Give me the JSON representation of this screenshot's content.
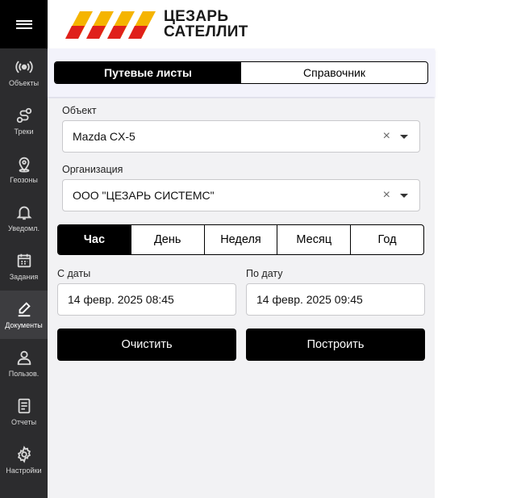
{
  "brand": {
    "line1": "ЦЕЗАРЬ",
    "line2": "САТЕЛЛИТ",
    "accent": "#f5b400",
    "accent2": "#e0201b"
  },
  "sidebar": {
    "items": [
      {
        "label": "Объекты",
        "icon": "broadcast-icon"
      },
      {
        "label": "Треки",
        "icon": "route-icon"
      },
      {
        "label": "Геозоны",
        "icon": "map-pin-icon"
      },
      {
        "label": "Уведомл.",
        "icon": "bell-icon"
      },
      {
        "label": "Задания",
        "icon": "calendar-icon"
      },
      {
        "label": "Документы",
        "icon": "pen-icon"
      },
      {
        "label": "Пользов.",
        "icon": "user-icon"
      },
      {
        "label": "Отчеты",
        "icon": "document-icon"
      },
      {
        "label": "Настройки",
        "icon": "gear-icon"
      }
    ],
    "active": "Документы"
  },
  "tabs": [
    "Путевые листы",
    "Справочник"
  ],
  "form": {
    "object_label": "Объект",
    "object_value": "Mazda CX-5",
    "org_label": "Организация",
    "org_value": "ООО \"ЦЕЗАРЬ СИСТЕМС\"",
    "clear_symbol": "×",
    "periods": [
      "Час",
      "День",
      "Неделя",
      "Месяц",
      "Год"
    ],
    "active_period": "Час",
    "from_label": "С даты",
    "from_value": "14 февр. 2025 08:45",
    "to_label": "По дату",
    "to_value": "14 февр. 2025 09:45",
    "clear_button": "Очистить",
    "build_button": "Построить"
  }
}
